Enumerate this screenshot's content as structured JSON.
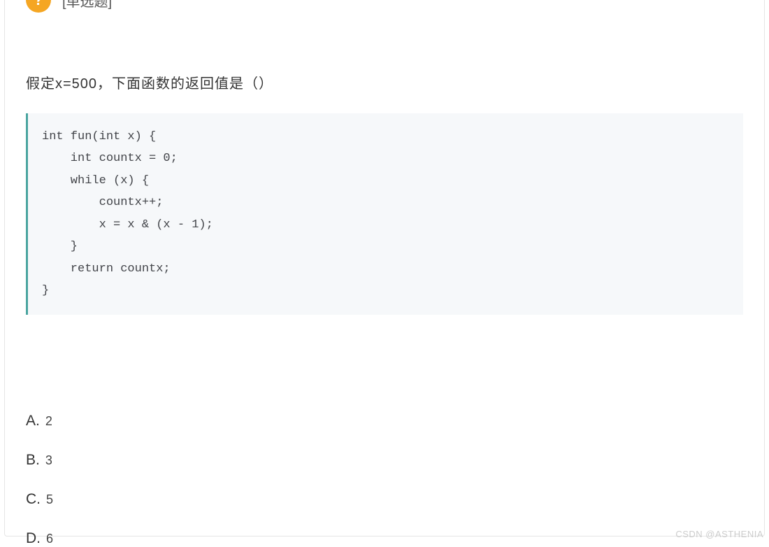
{
  "header": {
    "badge_glyph": "?",
    "qtype_label": "[单选题]"
  },
  "question": {
    "text": "假定x=500，下面函数的返回值是（）"
  },
  "code": {
    "content": "int fun(int x) {\n    int countx = 0;\n    while (x) {\n        countx++;\n        x = x & (x - 1);\n    }\n    return countx;\n}"
  },
  "options": [
    {
      "letter": "A.",
      "value": "2"
    },
    {
      "letter": "B.",
      "value": "3"
    },
    {
      "letter": "C.",
      "value": "5"
    },
    {
      "letter": "D.",
      "value": "6"
    }
  ],
  "watermark": "CSDN @ASTHENIA"
}
